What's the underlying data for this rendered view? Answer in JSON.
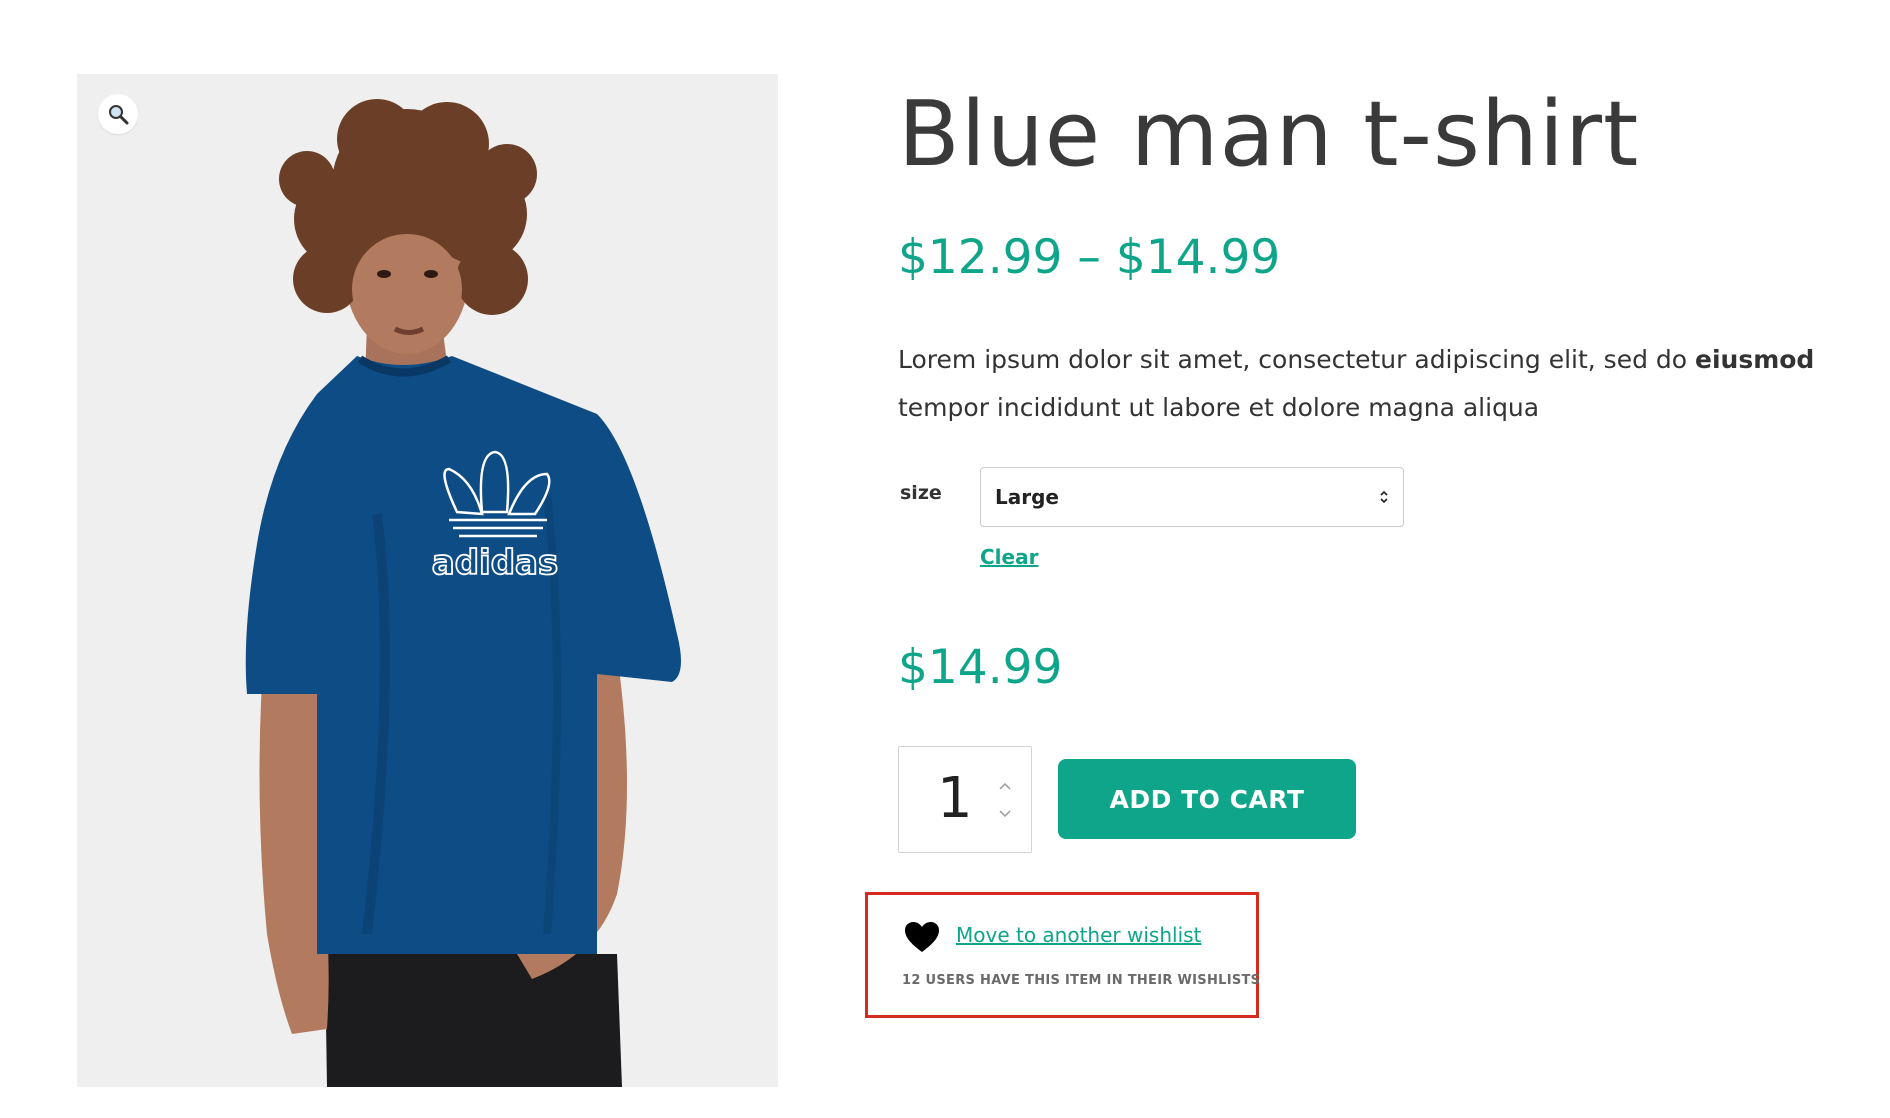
{
  "product": {
    "title": "Blue man t-shirt",
    "price_range": "$12.99 – $14.99",
    "description_start": "Lorem ipsum dolor sit amet, consectetur adipiscing elit, sed do ",
    "description_bold": "eiusmod",
    "description_end": " tempor incididunt ut labore et dolore magna aliqua",
    "image_logo_text": "adidas"
  },
  "variation": {
    "size_label": "size",
    "size_selected": "Large",
    "clear_label": "Clear",
    "price": "$14.99"
  },
  "cart": {
    "quantity": "1",
    "add_to_cart_label": "ADD TO CART"
  },
  "wishlist": {
    "link_label": "Move to another wishlist",
    "count_text": "12 USERS HAVE THIS ITEM IN THEIR WISHLISTS"
  },
  "icons": {
    "zoom": "magnifier-icon",
    "heart": "heart-icon",
    "select": "chevron-up-down-icon",
    "qty_up": "chevron-up-icon",
    "qty_down": "chevron-down-icon"
  },
  "colors": {
    "accent": "#0fa58a",
    "title": "#3a3a3a",
    "highlight_border": "#d52b1e",
    "image_background": "#efefef",
    "shirt": "#0e4c85"
  }
}
